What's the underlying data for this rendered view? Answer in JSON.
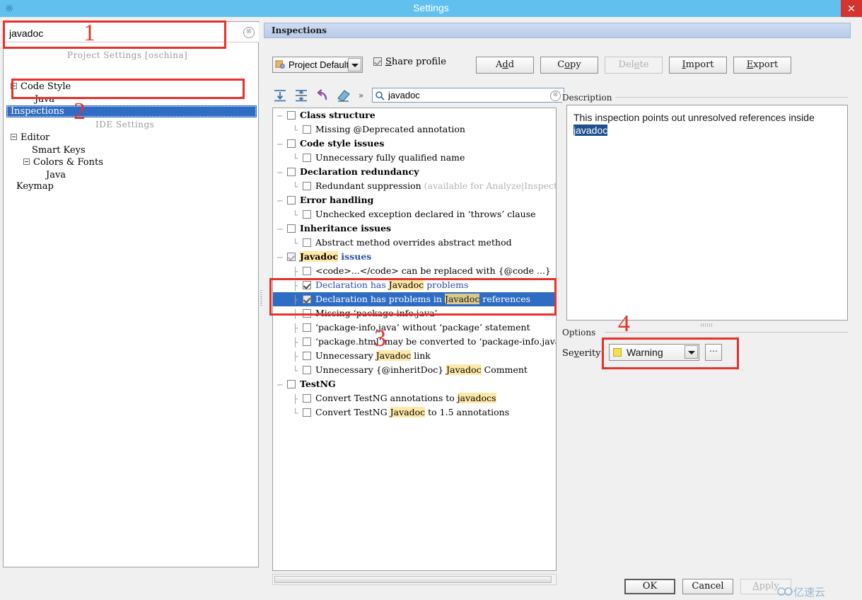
{
  "window": {
    "title": "Settings",
    "icon": "idea-logo-icon",
    "close_label": "✕"
  },
  "sidebar": {
    "search": {
      "value": "javadoc",
      "placeholder": "",
      "clear_label": "⊗"
    },
    "groups": [
      {
        "caption": "Project Settings [oschina]"
      },
      {
        "caption": "IDE Settings"
      }
    ],
    "items": [
      {
        "label": "Code Style",
        "expandable": true
      },
      {
        "label": "Java",
        "expandable": false
      },
      {
        "label": "Inspections",
        "expandable": false,
        "selected": true
      },
      {
        "label": "Editor",
        "expandable": true
      },
      {
        "label": "Smart Keys",
        "expandable": false
      },
      {
        "label": "Colors & Fonts",
        "expandable": true
      },
      {
        "label": "Java",
        "expandable": false
      },
      {
        "label": "Keymap",
        "expandable": false
      }
    ]
  },
  "panel": {
    "header_title": "Inspections",
    "profile": {
      "label": "Project Default",
      "icon": "profile-icon"
    },
    "share_profile": {
      "label": "Share profile",
      "checked": true
    },
    "buttons": [
      {
        "label": "Add",
        "mnemonic": "d",
        "enabled": true
      },
      {
        "label": "Copy",
        "mnemonic": "o",
        "enabled": true
      },
      {
        "label": "Delete",
        "mnemonic": "e",
        "enabled": false
      },
      {
        "label": "Import",
        "mnemonic": "I",
        "enabled": true
      },
      {
        "label": "Export",
        "mnemonic": "E",
        "enabled": true
      }
    ],
    "toolbar": {
      "expand_all": "expand-all-icon",
      "collapse_all": "collapse-all-icon",
      "reset_icon": "undo-icon",
      "eraser_icon": "eraser-icon",
      "chevrons": "»"
    },
    "filter": {
      "value": "javadoc",
      "placeholder": "",
      "clear_label": "⊗",
      "icon": "search-icon"
    }
  },
  "tree": {
    "rows": [
      {
        "indent": 0,
        "guide": "─",
        "state": "unchecked",
        "bold": true,
        "parts": [
          {
            "t": "Class structure"
          }
        ]
      },
      {
        "indent": 1,
        "guide": "└",
        "state": "unchecked",
        "bold": false,
        "parts": [
          {
            "t": "Missing @Deprecated annotation"
          }
        ]
      },
      {
        "indent": 0,
        "guide": "─",
        "state": "unchecked",
        "bold": true,
        "parts": [
          {
            "t": "Code style issues"
          }
        ]
      },
      {
        "indent": 1,
        "guide": "└",
        "state": "unchecked",
        "bold": false,
        "parts": [
          {
            "t": "Unnecessary fully qualified name"
          }
        ]
      },
      {
        "indent": 0,
        "guide": "─",
        "state": "unchecked",
        "bold": true,
        "parts": [
          {
            "t": "Declaration redundancy"
          }
        ]
      },
      {
        "indent": 1,
        "guide": "└",
        "state": "unchecked",
        "bold": false,
        "parts": [
          {
            "t": "Redundant suppression "
          },
          {
            "t": "(available for Analyze|Inspect Code)",
            "style": "dim"
          }
        ]
      },
      {
        "indent": 0,
        "guide": "─",
        "state": "unchecked",
        "bold": true,
        "parts": [
          {
            "t": "Error handling"
          }
        ]
      },
      {
        "indent": 1,
        "guide": "└",
        "state": "unchecked",
        "bold": false,
        "parts": [
          {
            "t": "Unchecked exception declared in ‘throws’ clause"
          }
        ]
      },
      {
        "indent": 0,
        "guide": "─",
        "state": "unchecked",
        "bold": true,
        "parts": [
          {
            "t": "Inheritance issues"
          }
        ]
      },
      {
        "indent": 1,
        "guide": "└",
        "state": "unchecked",
        "bold": false,
        "parts": [
          {
            "t": "Abstract method overrides abstract method"
          }
        ]
      },
      {
        "indent": 0,
        "guide": "─",
        "state": "partial",
        "bold": true,
        "parts": [
          {
            "t": "Javadoc",
            "style": "hl"
          },
          {
            "t": " issues",
            "style": "blue"
          }
        ]
      },
      {
        "indent": 1,
        "guide": "├",
        "state": "unchecked",
        "bold": false,
        "parts": [
          {
            "t": "<code>...</code> can be replaced with {@code ...}"
          }
        ]
      },
      {
        "indent": 1,
        "guide": "├",
        "state": "checked",
        "bold": false,
        "blue": true,
        "parts": [
          {
            "t": "Declaration has ",
            "style": "blue"
          },
          {
            "t": "Javadoc",
            "style": "hl"
          },
          {
            "t": " problems",
            "style": "blue"
          }
        ]
      },
      {
        "indent": 1,
        "guide": "├",
        "state": "checked-gray",
        "bold": false,
        "selected": true,
        "parts": [
          {
            "t": "Declaration has problems in "
          },
          {
            "t": "Javadoc",
            "style": "hl"
          },
          {
            "t": " references"
          }
        ]
      },
      {
        "indent": 1,
        "guide": "├",
        "state": "unchecked",
        "bold": false,
        "parts": [
          {
            "t": "Missing ‘package-info.java’"
          }
        ]
      },
      {
        "indent": 1,
        "guide": "├",
        "state": "unchecked",
        "bold": false,
        "parts": [
          {
            "t": "‘package-info.java’ without ‘package’ statement"
          }
        ]
      },
      {
        "indent": 1,
        "guide": "├",
        "state": "unchecked",
        "bold": false,
        "parts": [
          {
            "t": "‘package.html’ may be converted to ‘package-info.java’"
          }
        ]
      },
      {
        "indent": 1,
        "guide": "├",
        "state": "unchecked",
        "bold": false,
        "parts": [
          {
            "t": "Unnecessary "
          },
          {
            "t": "Javadoc",
            "style": "hl"
          },
          {
            "t": " link"
          }
        ]
      },
      {
        "indent": 1,
        "guide": "└",
        "state": "unchecked",
        "bold": false,
        "parts": [
          {
            "t": "Unnecessary {@inheritDoc} "
          },
          {
            "t": "Javadoc",
            "style": "hl"
          },
          {
            "t": " Comment"
          }
        ]
      },
      {
        "indent": 0,
        "guide": "─",
        "state": "unchecked",
        "bold": true,
        "parts": [
          {
            "t": "TestNG"
          }
        ]
      },
      {
        "indent": 1,
        "guide": "├",
        "state": "unchecked",
        "bold": false,
        "parts": [
          {
            "t": "Convert TestNG annotations to "
          },
          {
            "t": "javadocs",
            "style": "hl"
          }
        ]
      },
      {
        "indent": 1,
        "guide": "└",
        "state": "unchecked",
        "bold": false,
        "parts": [
          {
            "t": "Convert TestNG "
          },
          {
            "t": "Javadoc",
            "style": "hl"
          },
          {
            "t": " to 1.5 annotations"
          }
        ]
      }
    ]
  },
  "description": {
    "group_label": "Description",
    "text_before": "This inspection points out unresolved references inside ",
    "text_selected": "javadoc"
  },
  "options": {
    "group_label": "Options",
    "severity_label": "Severity:",
    "severity_value": "Warning",
    "severity_color": "#f2e14c",
    "more_label": "⋯"
  },
  "footer": {
    "ok": "OK",
    "cancel": "Cancel",
    "apply": "Apply",
    "watermark": "亿速云"
  },
  "annotations": [
    {
      "number": "1"
    },
    {
      "number": "2"
    },
    {
      "number": "3"
    },
    {
      "number": "4"
    }
  ],
  "colors": {
    "titlebar": "#62c0ee",
    "selection": "#2f6cc4",
    "annotation": "#e8312a",
    "highlight": "#ffe9a8"
  }
}
